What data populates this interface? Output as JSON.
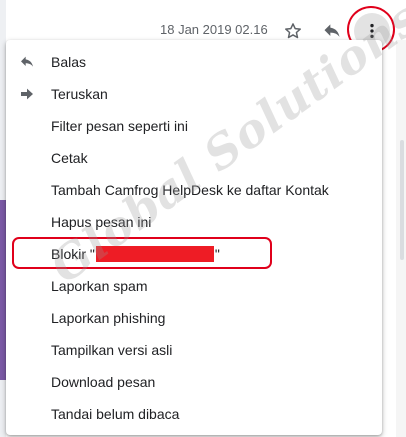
{
  "header": {
    "timestamp": "18 Jan 2019 02.16",
    "icons": [
      "star-icon",
      "reply-icon",
      "more-vert-icon"
    ]
  },
  "menu": {
    "items": [
      {
        "label": "Balas",
        "icon": "reply-icon"
      },
      {
        "label": "Teruskan",
        "icon": "forward-icon"
      },
      {
        "label": "Filter pesan seperti ini"
      },
      {
        "label": "Cetak"
      },
      {
        "label": "Tambah Camfrog HelpDesk ke daftar Kontak"
      },
      {
        "label": "Hapus pesan ini"
      },
      {
        "label_prefix": "Blokir \"",
        "label_suffix": "\""
      },
      {
        "label": "Laporkan spam"
      },
      {
        "label": "Laporkan phishing"
      },
      {
        "label": "Tampilkan versi asli"
      },
      {
        "label": "Download pesan"
      },
      {
        "label": "Tandai belum dibaca"
      }
    ]
  },
  "watermark": "Global Solutions",
  "colors": {
    "annotation_red": "#e0001b",
    "redaction_red": "#ee1c25",
    "menu_text": "#202124",
    "icon_gray": "#5f6368"
  }
}
